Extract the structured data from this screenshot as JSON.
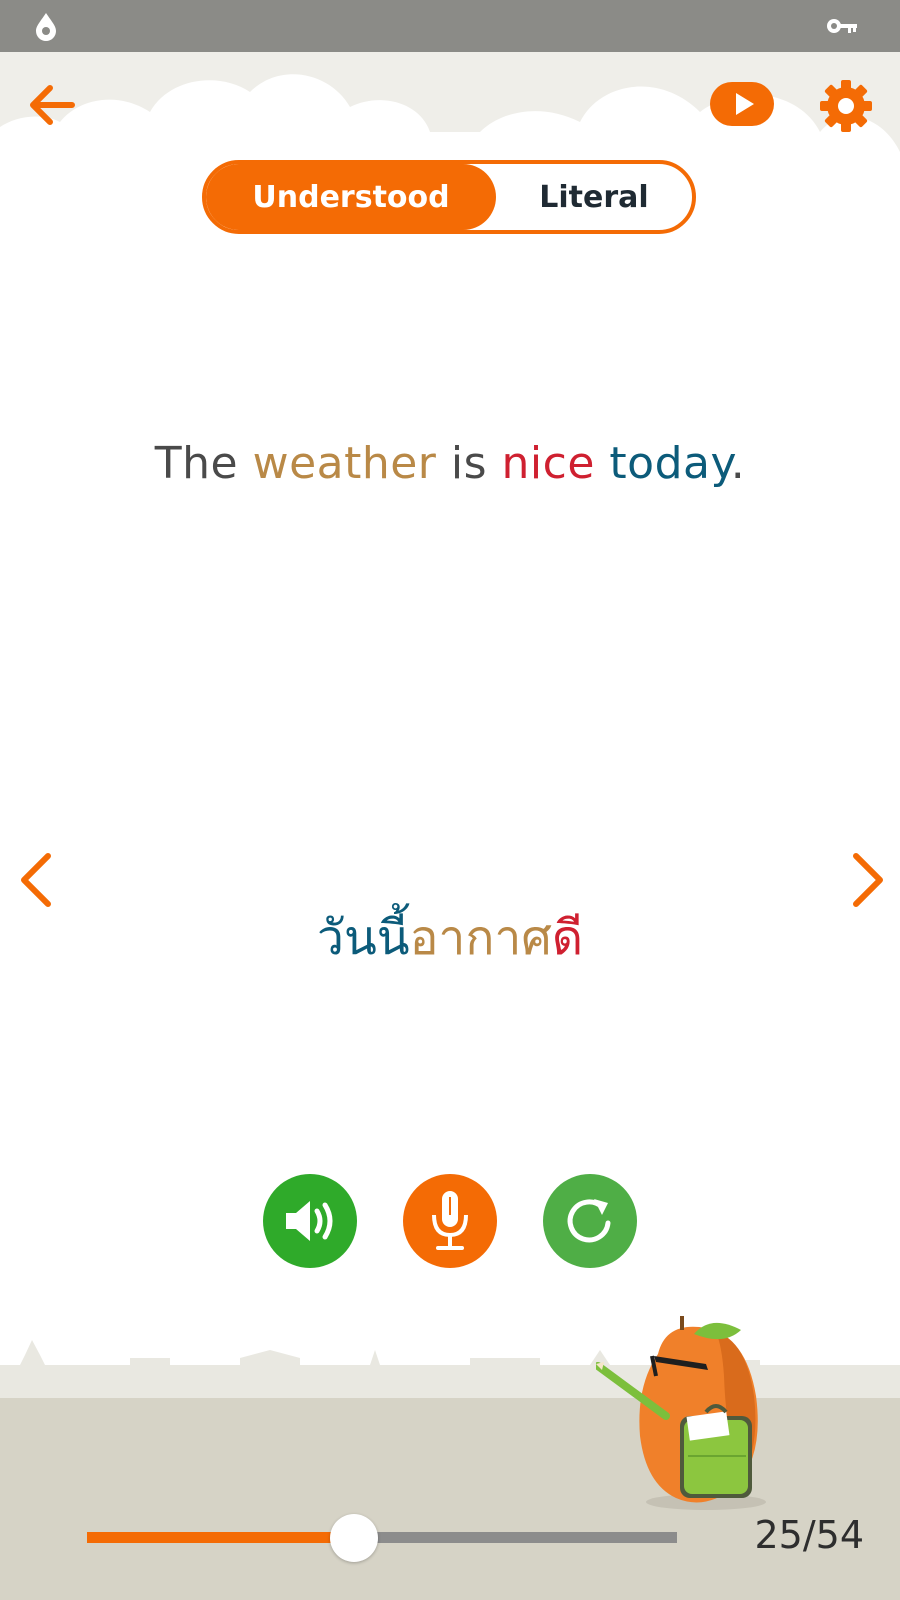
{
  "status_bar": {
    "icons": [
      "water-drop-icon",
      "key-icon"
    ]
  },
  "toolbar": {
    "icons": [
      "back-arrow-icon",
      "play-icon",
      "gear-icon"
    ]
  },
  "mode_toggle": {
    "options": [
      "Understood",
      "Literal"
    ],
    "selected": "Understood"
  },
  "sentence": {
    "english": [
      {
        "text": "The ",
        "color": "#4a4a4a"
      },
      {
        "text": "weather",
        "color": "#b98947"
      },
      {
        "text": " is ",
        "color": "#4a4a4a"
      },
      {
        "text": "nice",
        "color": "#cf2030"
      },
      {
        "text": " ",
        "color": "#4a4a4a"
      },
      {
        "text": "today",
        "color": "#0c5b7a"
      },
      {
        "text": ".",
        "color": "#4a4a4a"
      }
    ],
    "thai": [
      {
        "text": "วันนี้",
        "color": "#0c5b7a"
      },
      {
        "text": "อากาศ",
        "color": "#b98947"
      },
      {
        "text": "ดี",
        "color": "#cf2030"
      }
    ]
  },
  "actions": {
    "icons": [
      "speaker-icon",
      "microphone-icon",
      "replay-icon"
    ]
  },
  "progress": {
    "current": 25,
    "total": 54,
    "label": "25/54"
  },
  "colors": {
    "accent": "#f46b05",
    "speaker_green": "#2faa2a",
    "replay_green": "#4fae46",
    "ground": "#d6d3c6"
  }
}
